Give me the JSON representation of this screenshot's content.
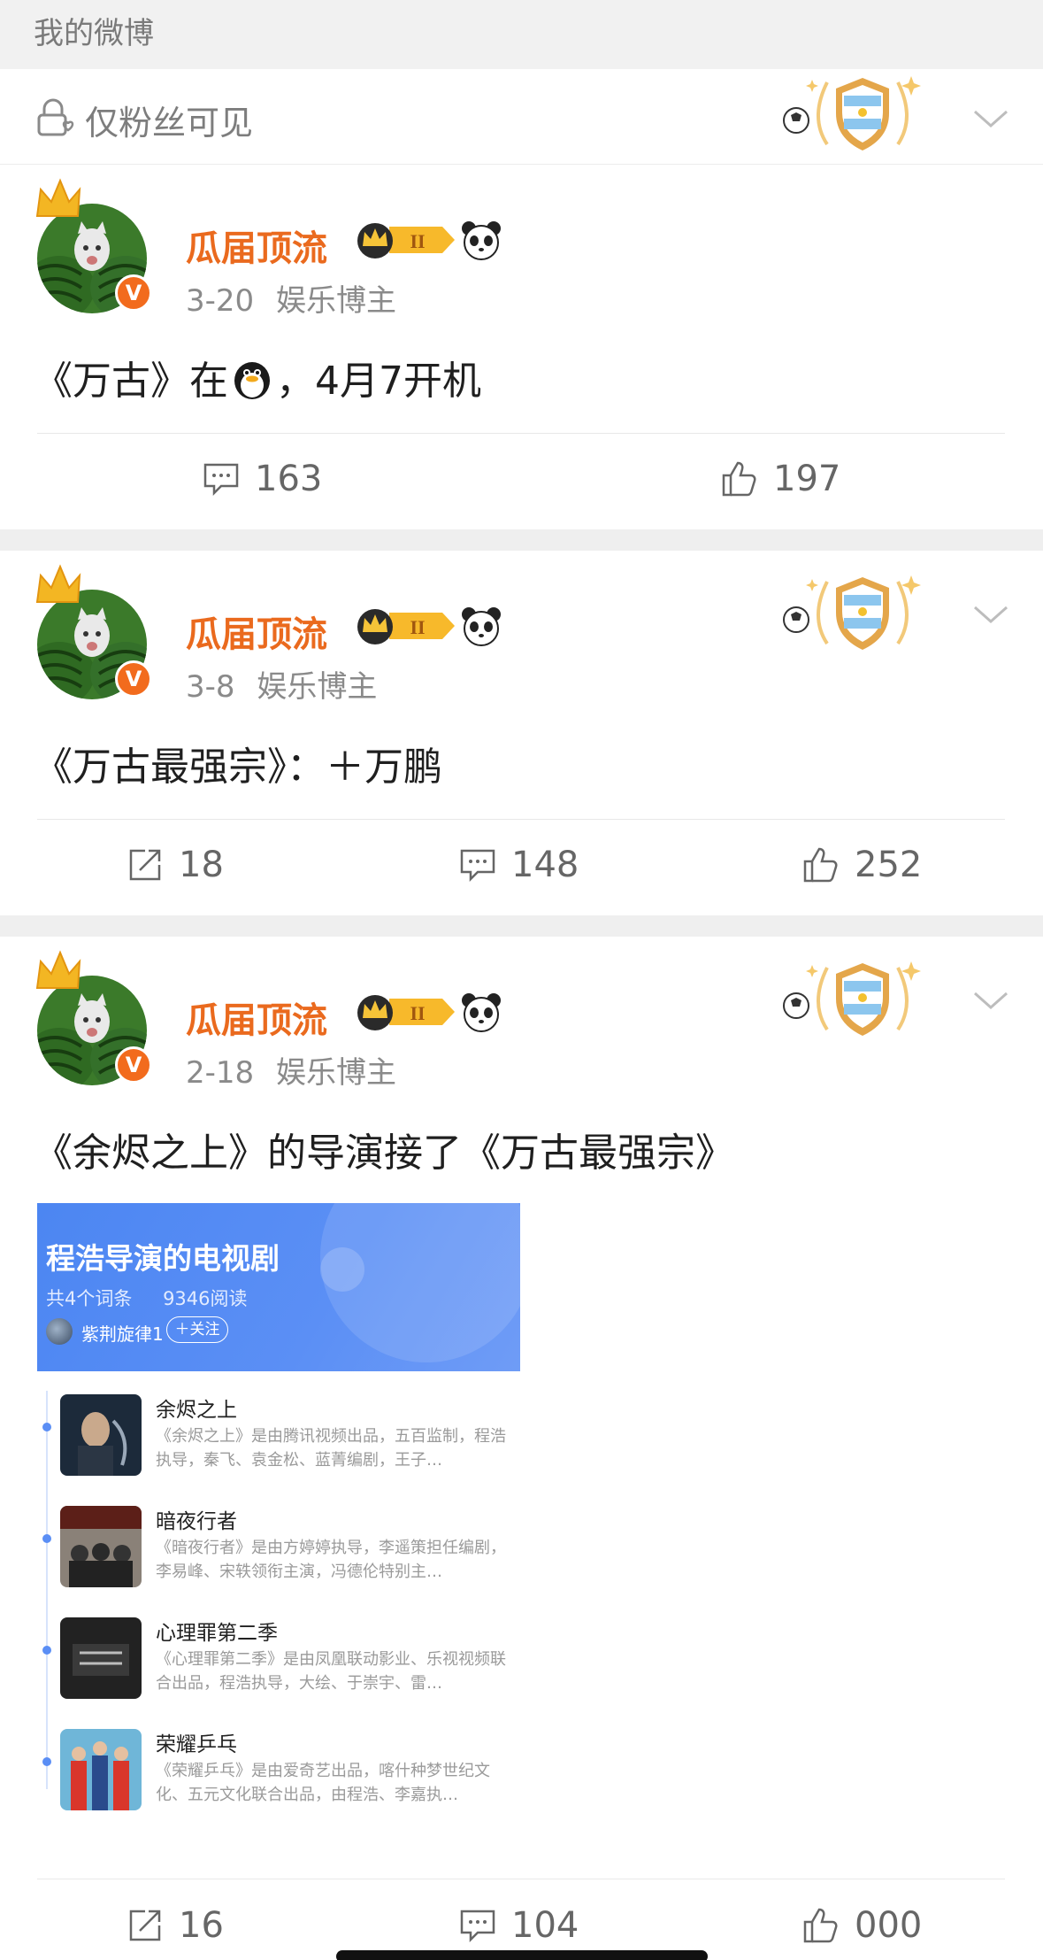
{
  "header": {
    "title": "我的微博"
  },
  "privacy": {
    "label": "仅粉丝可见"
  },
  "posts": [
    {
      "author": "瓜届顶流",
      "date": "3-20",
      "category": "娱乐博主",
      "text_before": "《万古》在",
      "text_after": "，4月7开机",
      "emoji": "penguin-icon",
      "actions": {
        "comments": "163",
        "likes": "197"
      }
    },
    {
      "author": "瓜届顶流",
      "date": "3-8",
      "category": "娱乐博主",
      "text": "《万古最强宗》：＋万鹏",
      "actions": {
        "reposts": "18",
        "comments": "148",
        "likes": "252"
      }
    },
    {
      "author": "瓜届顶流",
      "date": "2-18",
      "category": "娱乐博主",
      "text": "《余烬之上》的导演接了《万古最强宗》",
      "actions": {
        "reposts": "16",
        "comments": "104",
        "likes": "000"
      }
    }
  ],
  "card": {
    "title": "程浩导演的电视剧",
    "entries": "共4个词条",
    "reads": "9346阅读",
    "author": "紫荆旋律1",
    "follow": "＋关注",
    "items": [
      {
        "name": "余烬之上",
        "desc": "《余烬之上》是由腾讯视频出品，五百监制，程浩执导，秦飞、袁金松、蓝菁编剧，王子…"
      },
      {
        "name": "暗夜行者",
        "desc": "《暗夜行者》是由方婷婷执导，李遥策担任编剧，李易峰、宋轶领衔主演，冯德伦特别主…"
      },
      {
        "name": "心理罪第二季",
        "desc": "《心理罪第二季》是由凤凰联动影业、乐视视频联合出品，程浩执导，大绘、于崇宇、雷…"
      },
      {
        "name": "荣耀乒乓",
        "desc": "《荣耀乒乓》是由爱奇艺出品，喀什种梦世纪文化、五元文化联合出品，由程浩、李嘉执…"
      }
    ]
  },
  "colors": {
    "username": "#ea6a1e",
    "verified": "#f26b1d",
    "card_blue": "#4c86f2"
  }
}
